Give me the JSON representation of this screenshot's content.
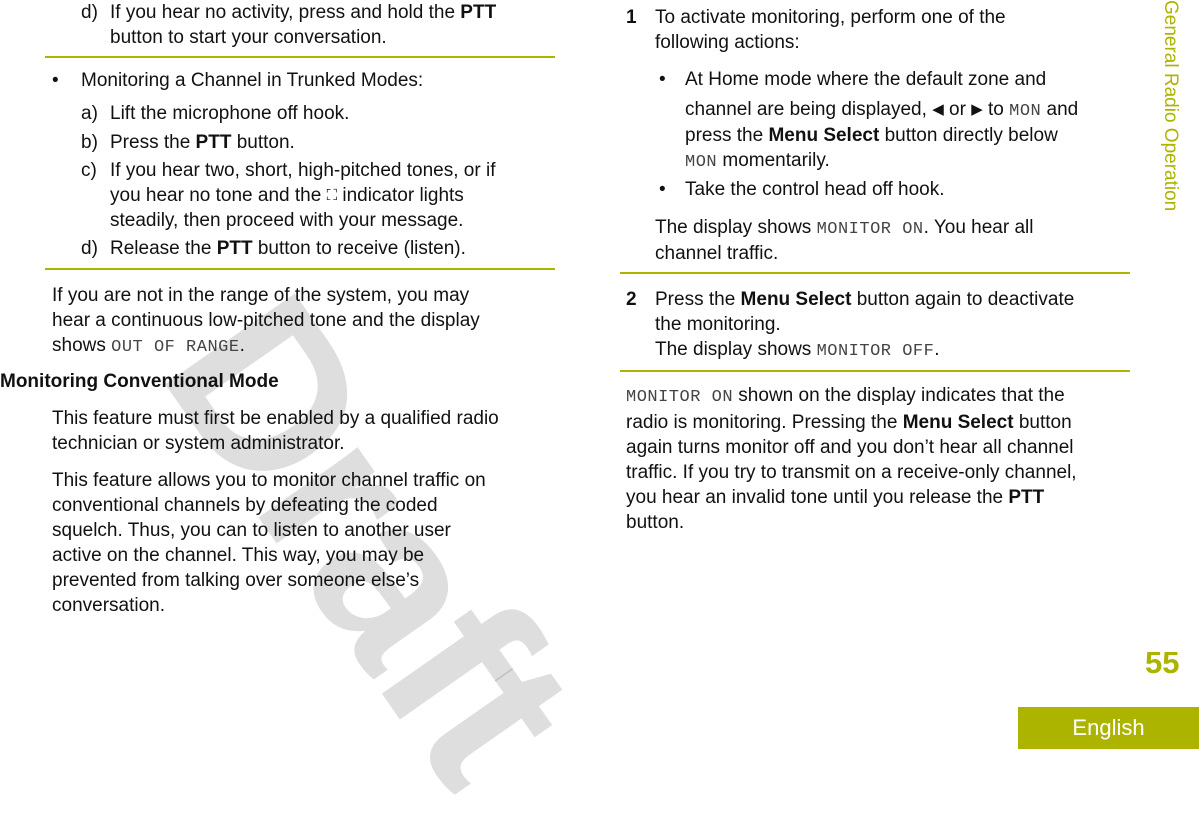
{
  "left_lines": [
    {
      "m": "d)",
      "s": [
        {
          "t": "If you hear no activity, press and hold the "
        },
        {
          "t": "PTT",
          "st": "b"
        }
      ]
    },
    {
      "s": [
        {
          "t": "button to start your conversation."
        }
      ]
    },
    {
      "m": "•",
      "s": [
        {
          "t": "Monitoring a Channel in Trunked Modes:"
        }
      ]
    },
    {
      "m": "a)",
      "s": [
        {
          "t": "Lift the microphone off hook."
        }
      ]
    },
    {
      "m": "b)",
      "s": [
        {
          "t": "Press the "
        },
        {
          "t": "PTT",
          "st": "b"
        },
        {
          "t": " button."
        }
      ]
    },
    {
      "m": "c)",
      "s": [
        {
          "t": "If you hear two, short, high-pitched tones, or if"
        }
      ]
    },
    {
      "s": [
        {
          "t": "you hear no tone and the "
        },
        {
          "icon": "trunking-indicator-icon",
          "t": "⛶"
        },
        {
          "t": " indicator lights"
        }
      ]
    },
    {
      "s": [
        {
          "t": "steadily, then proceed with your message."
        }
      ]
    },
    {
      "m": "d)",
      "s": [
        {
          "t": "Release the "
        },
        {
          "t": "PTT",
          "st": "b"
        },
        {
          "t": " button to receive (listen)."
        }
      ]
    },
    {
      "s": [
        {
          "t": "If you are not in the range of the system, you may"
        }
      ]
    },
    {
      "s": [
        {
          "t": "hear a continuous low-pitched tone and the display"
        }
      ]
    },
    {
      "s": [
        {
          "t": "shows "
        },
        {
          "t": "OUT OF RANGE",
          "st": "m"
        },
        {
          "t": "."
        }
      ]
    },
    {
      "s": [
        {
          "t": "Monitoring Conventional Mode",
          "st": "b"
        }
      ]
    },
    {
      "s": [
        {
          "t": "This feature must first be enabled by a qualified radio"
        }
      ]
    },
    {
      "s": [
        {
          "t": "technician or system administrator."
        }
      ]
    },
    {
      "s": [
        {
          "t": "This feature allows you to monitor channel traffic on"
        }
      ]
    },
    {
      "s": [
        {
          "t": "conventional channels by defeating the coded"
        }
      ]
    },
    {
      "s": [
        {
          "t": "squelch. Thus, you can to listen to another user"
        }
      ]
    },
    {
      "s": [
        {
          "t": "active on the channel. This way, you may be"
        }
      ]
    },
    {
      "s": [
        {
          "t": "prevented from talking over someone else’s"
        }
      ]
    },
    {
      "s": [
        {
          "t": "conversation."
        }
      ]
    }
  ],
  "right_lines": [
    {
      "m": "1",
      "s": [
        {
          "t": "To activate monitoring, perform one of the"
        }
      ]
    },
    {
      "s": [
        {
          "t": "following actions:"
        }
      ]
    },
    {
      "m": "•",
      "s": [
        {
          "t": "At Home mode where the default zone and"
        }
      ]
    },
    {
      "s": [
        {
          "t": "channel are being displayed, "
        },
        {
          "icon": "left-arrow-icon",
          "t": "◀"
        },
        {
          "t": " or "
        },
        {
          "icon": "right-arrow-icon",
          "t": "▶"
        },
        {
          "t": " to "
        },
        {
          "t": "MON",
          "st": "m"
        },
        {
          "t": " and"
        }
      ]
    },
    {
      "s": [
        {
          "t": "press the "
        },
        {
          "t": "Menu Select",
          "st": "b"
        },
        {
          "t": " button directly below"
        }
      ]
    },
    {
      "s": [
        {
          "t": "MON",
          "st": "m"
        },
        {
          "t": " momentarily."
        }
      ]
    },
    {
      "m": "•",
      "s": [
        {
          "t": "Take the control head off hook."
        }
      ]
    },
    {
      "s": [
        {
          "t": "The display shows "
        },
        {
          "t": "MONITOR ON",
          "st": "m"
        },
        {
          "t": ". You hear all"
        }
      ]
    },
    {
      "s": [
        {
          "t": "channel traffic."
        }
      ]
    },
    {
      "m": "2",
      "s": [
        {
          "t": "Press the "
        },
        {
          "t": "Menu Select",
          "st": "b"
        },
        {
          "t": " button again to deactivate"
        }
      ]
    },
    {
      "s": [
        {
          "t": "the monitoring."
        }
      ]
    },
    {
      "s": [
        {
          "t": "The display shows "
        },
        {
          "t": "MONITOR OFF",
          "st": "m"
        },
        {
          "t": "."
        }
      ]
    },
    {
      "s": [
        {
          "t": "MONITOR ON",
          "st": "m"
        },
        {
          "t": " shown on the display indicates that the"
        }
      ]
    },
    {
      "s": [
        {
          "t": "radio is monitoring. Pressing the "
        },
        {
          "t": "Menu Select",
          "st": "b"
        },
        {
          "t": " button"
        }
      ]
    },
    {
      "s": [
        {
          "t": "again turns monitor off and you don’t hear all channel"
        }
      ]
    },
    {
      "s": [
        {
          "t": "traffic. If you try to transmit on a receive-only channel,"
        }
      ]
    },
    {
      "s": [
        {
          "t": "you hear an invalid tone until you release the "
        },
        {
          "t": "PTT",
          "st": "b"
        }
      ]
    },
    {
      "s": [
        {
          "t": "button."
        }
      ]
    }
  ],
  "watermark": "Draft",
  "section_title": "General Radio Operation",
  "page_number": "55",
  "language_tab": "English",
  "colors": {
    "accent": "#acb400"
  }
}
